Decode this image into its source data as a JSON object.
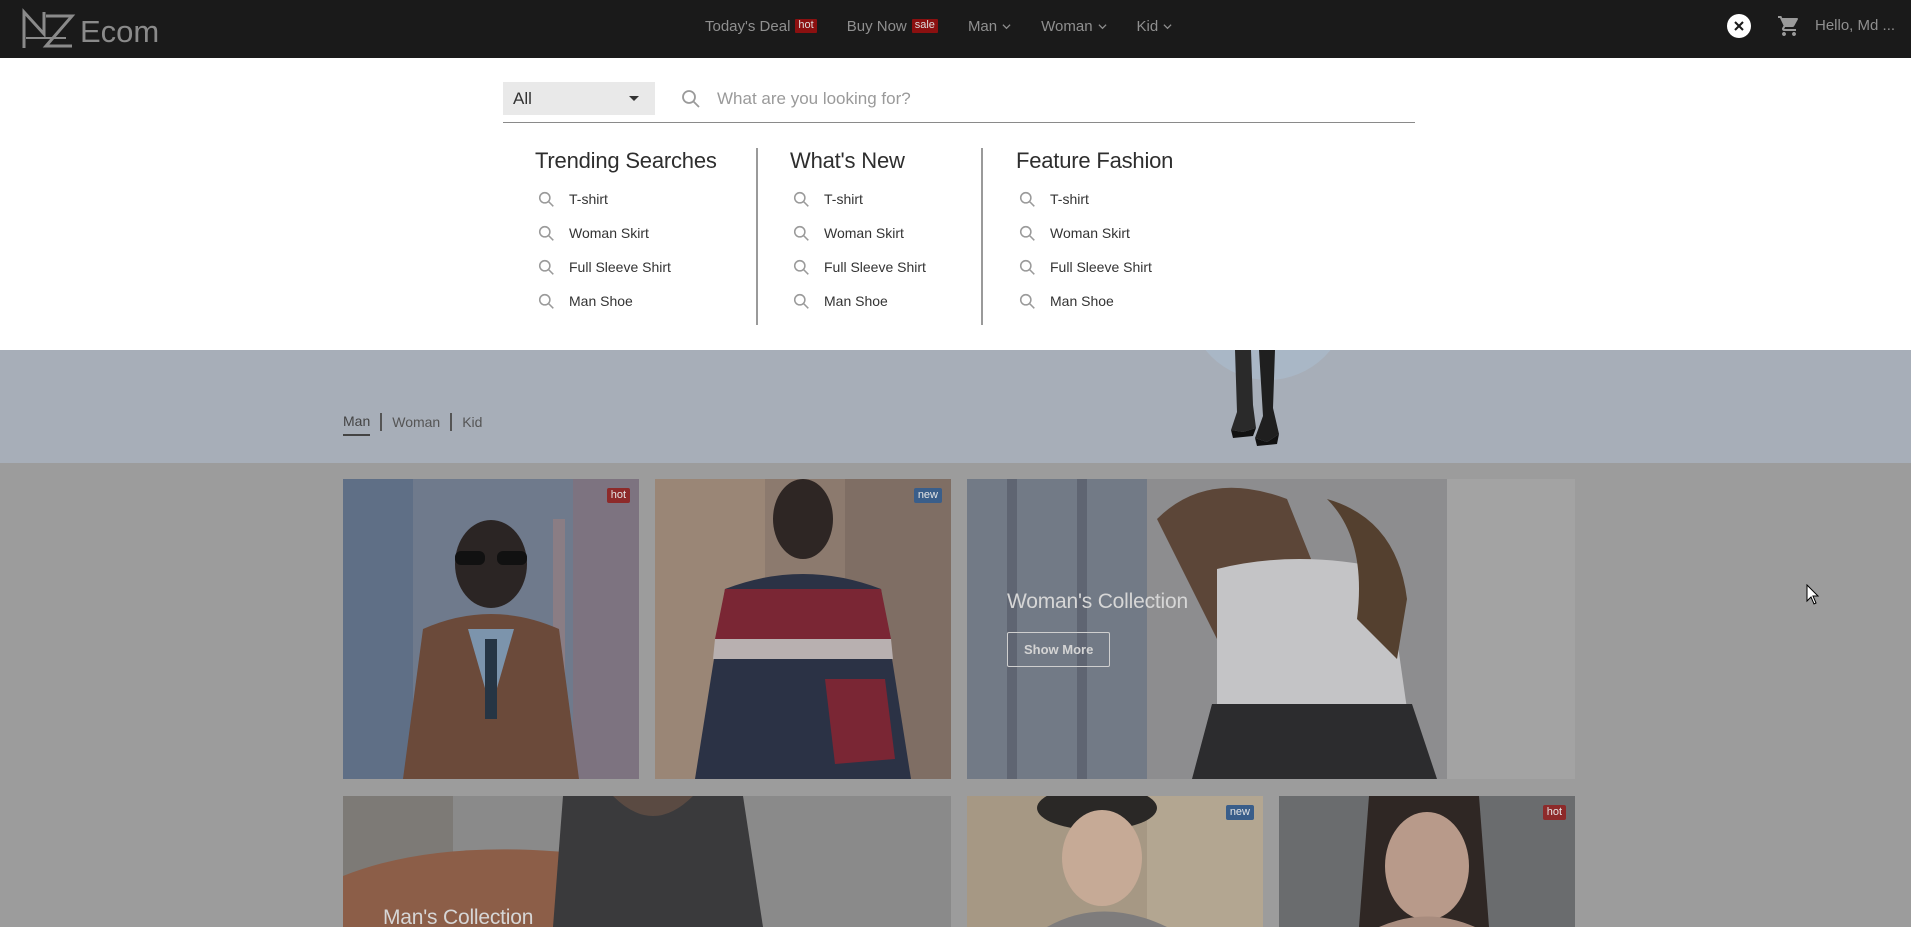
{
  "brand": {
    "logo_mark": "MZ",
    "name": "Ecom"
  },
  "nav": {
    "items": [
      {
        "label": "Today's Deal",
        "badge": "hot"
      },
      {
        "label": "Buy Now",
        "badge": "sale"
      },
      {
        "label": "Man",
        "dropdown": true
      },
      {
        "label": "Woman",
        "dropdown": true
      },
      {
        "label": "Kid",
        "dropdown": true
      }
    ],
    "greeting": "Hello, Md ..."
  },
  "search": {
    "category": "All",
    "placeholder": "What are you looking for?",
    "columns": [
      {
        "title": "Trending Searches",
        "items": [
          "T-shirt",
          "Woman Skirt",
          "Full Sleeve Shirt",
          "Man Shoe"
        ]
      },
      {
        "title": "What's New",
        "items": [
          "T-shirt",
          "Woman Skirt",
          "Full Sleeve Shirt",
          "Man Shoe"
        ]
      },
      {
        "title": "Feature Fashion",
        "items": [
          "T-shirt",
          "Woman Skirt",
          "Full Sleeve Shirt",
          "Man Shoe"
        ]
      }
    ]
  },
  "tabs": [
    "Man",
    "Woman",
    "Kid"
  ],
  "active_tab": "Man",
  "cards": {
    "leather_jacket_badge": "hot",
    "windbreaker_badge": "new",
    "womans_collection": {
      "title": "Woman's Collection",
      "button": "Show More"
    },
    "mans_collection": {
      "title": "Man's Collection"
    },
    "beret_badge": "new",
    "portrait_badge": "hot"
  },
  "icons": {
    "close": "close-icon",
    "cart": "cart-icon",
    "search": "search-icon",
    "chevron": "chevron-down-icon"
  },
  "colors": {
    "navbar_bg": "#1a1a1a",
    "hot_badge": "#8b1010",
    "new_badge": "#3a5e8a"
  }
}
